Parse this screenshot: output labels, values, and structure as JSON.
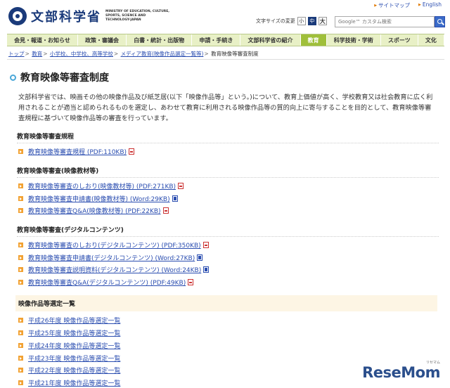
{
  "header": {
    "logo_text": "文部科学省",
    "logo_en": "MINISTRY OF EDUCATION, CULTURE, SPORTS, SCIENCE AND TECHNOLOGY-JAPAN",
    "top_links": [
      "サイトマップ",
      "English"
    ],
    "font_size_label": "文字サイズの変更",
    "font_sizes": [
      "小",
      "中",
      "大"
    ],
    "search_placeholder": "Google™ カスタム検索"
  },
  "nav": [
    "会見・報道・お知らせ",
    "政策・審議会",
    "白書・統計・出版物",
    "申請・手続き",
    "文部科学省の紹介",
    "教育",
    "科学技術・学術",
    "スポーツ",
    "文化"
  ],
  "breadcrumb": {
    "items": [
      "トップ",
      "教育",
      "小学校、中学校、高等学校",
      "メディア教育(映像作品選定一覧等)"
    ],
    "current": "教育映像等審査制度"
  },
  "page": {
    "title": "教育映像等審査制度",
    "intro": "文部科学省では、映画その他の映像作品及び紙芝居(以下「映像作品等」という。)について、教育上価値が高く、学校教育又は社会教育に広く利用されることが適当と認められるものを選定し、あわせて教育に利用される映像作品等の質的向上に寄与することを目的として、教育映像等審査規程に基づいて映像作品等の審査を行っています。"
  },
  "sections": [
    {
      "heading": "教育映像等審査規程",
      "links": [
        {
          "label": "教育映像等審査規程 (PDF:110KB)",
          "icon": "pdf-icon"
        }
      ]
    },
    {
      "heading": "教育映像等審査(映像教材等)",
      "links": [
        {
          "label": "教育映像等審査のしおり(映像教材等) (PDF:271KB)",
          "icon": "pdf-icon"
        },
        {
          "label": "教育映像等審査申請書(映像教材等) (Word:29KB)",
          "icon": "word-icon"
        },
        {
          "label": "教育映像等審査Q&A(映像教材等) (PDF:22KB)",
          "icon": "pdf-icon"
        }
      ]
    },
    {
      "heading": "教育映像等審査(デジタルコンテンツ)",
      "links": [
        {
          "label": "教育映像等審査のしおり(デジタルコンテンツ) (PDF:350KB)",
          "icon": "pdf-icon"
        },
        {
          "label": "教育映像等審査申請書(デジタルコンテンツ) (Word:27KB)",
          "icon": "word-icon"
        },
        {
          "label": "教育映像等審査説明資料(デジタルコンテンツ) (Word:24KB)",
          "icon": "word-icon"
        },
        {
          "label": "教育映像等審査Q&A(デジタルコンテンツ) (PDF:49KB)",
          "icon": "pdf-icon"
        }
      ]
    },
    {
      "heading": "映像作品等選定一覧",
      "links": [
        {
          "label": "平成26年度 映像作品等選定一覧"
        },
        {
          "label": "平成25年度 映像作品等選定一覧"
        },
        {
          "label": "平成24年度 映像作品等選定一覧"
        },
        {
          "label": "平成23年度 映像作品等選定一覧"
        },
        {
          "label": "平成22年度 映像作品等選定一覧"
        },
        {
          "label": "平成21年度 映像作品等選定一覧"
        }
      ]
    }
  ],
  "watermark": {
    "text": "ReseMom",
    "sub": "リセマム"
  }
}
